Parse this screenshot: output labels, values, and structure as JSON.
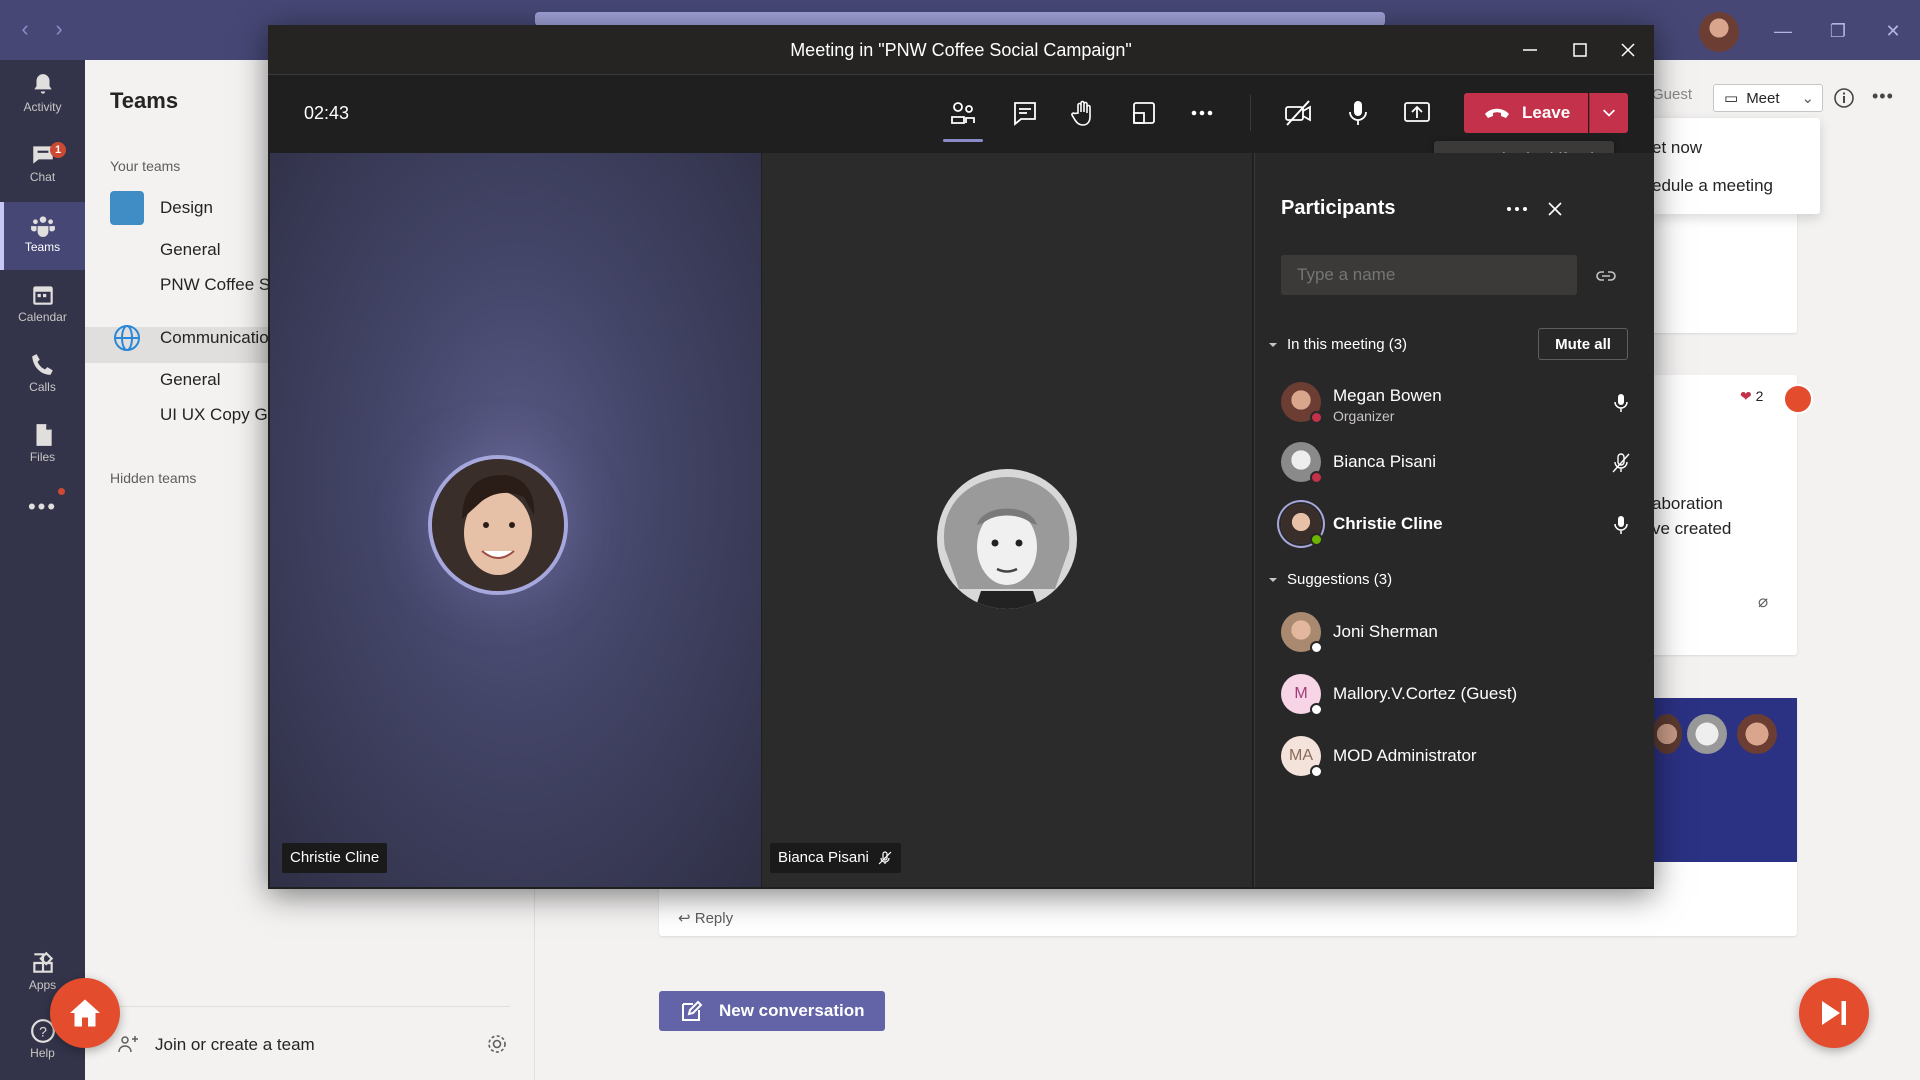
{
  "rail": {
    "items": [
      {
        "label": "Activity",
        "icon": "bell-icon"
      },
      {
        "label": "Chat",
        "icon": "chat-icon",
        "badge": "1"
      },
      {
        "label": "Teams",
        "icon": "teams-icon",
        "active": true
      },
      {
        "label": "Calendar",
        "icon": "calendar-icon"
      },
      {
        "label": "Calls",
        "icon": "phone-icon"
      },
      {
        "label": "Files",
        "icon": "files-icon"
      }
    ],
    "bottom": [
      {
        "label": "Apps",
        "icon": "apps-icon"
      },
      {
        "label": "Help",
        "icon": "help-icon"
      }
    ]
  },
  "teams_panel": {
    "title": "Teams",
    "your_teams": "Your teams",
    "teams": [
      {
        "name": "Design",
        "channels": [
          "General",
          "PNW Coffee S"
        ]
      },
      {
        "name": "Communicatio",
        "channels": [
          "General",
          "UI UX Copy G"
        ]
      }
    ],
    "hidden_teams": "Hidden teams",
    "join_create": "Join or create a team"
  },
  "background": {
    "guest": "Guest",
    "meet_label": "Meet",
    "meet_menu": [
      "et now",
      "edule a meeting"
    ],
    "reaction_count": "2",
    "snippet_line1": "aboration",
    "snippet_line2": "ve created",
    "reply": "Reply",
    "new_conversation": "New conversation"
  },
  "meeting": {
    "title": "Meeting in \"PNW Coffee Social Campaign\"",
    "timer": "02:43",
    "leave_label": "Leave",
    "tooltip": "Leave (Ctrl+Shift+B)",
    "tiles": [
      {
        "name": "Christie Cline",
        "muted": false
      },
      {
        "name": "Bianca Pisani",
        "muted": true
      }
    ],
    "participants": {
      "title": "Participants",
      "search_placeholder": "Type a name",
      "in_meeting_label": "In this meeting (3)",
      "mute_all": "Mute all",
      "in_meeting": [
        {
          "name": "Megan Bowen",
          "role": "Organizer",
          "status": "busy",
          "mic": "on"
        },
        {
          "name": "Bianca Pisani",
          "role": "",
          "status": "busy",
          "mic": "muted"
        },
        {
          "name": "Christie Cline",
          "role": "",
          "status": "available",
          "mic": "on",
          "speaking": true
        }
      ],
      "suggestions_label": "Suggestions (3)",
      "suggestions": [
        {
          "name": "Joni Sherman",
          "initials": ""
        },
        {
          "name": "Mallory.V.Cortez (Guest)",
          "initials": "M"
        },
        {
          "name": "MOD Administrator",
          "initials": "MA"
        }
      ]
    }
  },
  "colors": {
    "brand": "#464775",
    "rail": "#33344a",
    "leave": "#c4314b",
    "accent": "#6264a7",
    "fab": "#e34d2e"
  }
}
